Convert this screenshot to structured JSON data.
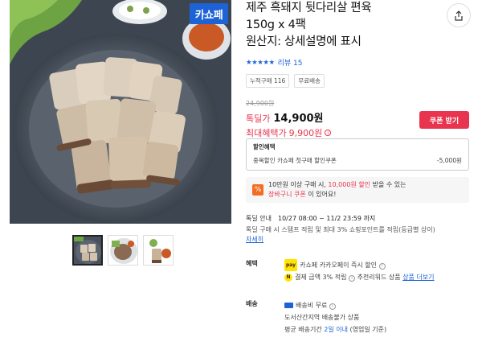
{
  "product": {
    "title_line1": "제주 흑돼지 뒷다리살 편육",
    "title_line2": "150g x 4팩",
    "title_line3": "원산지: 상세설명에 표시",
    "badge": "카쇼페",
    "stars": "★★★★★",
    "review_label": "리뷰 15",
    "chips": [
      "누적구매 116",
      "무료배송"
    ]
  },
  "price": {
    "original": "24,900원",
    "deal_label": "톡딜가",
    "deal_price": "14,900원",
    "max_label": "최대혜택가",
    "max_price": "9,900원",
    "info_icon": "i",
    "coupon_button": "쿠폰 받기"
  },
  "benefit": {
    "header": "할인혜택",
    "item_label": "중복할인 카쇼페 첫구매 할인쿠폰",
    "item_value": "-5,000원"
  },
  "promo": {
    "icon": "%",
    "text_a": "10만원 이상 구매 시, ",
    "text_highlight": "10,000원 할인",
    "text_b": " 받을 수 있는",
    "text_link": "장바구니 쿠폰",
    "text_c": "이 있어요!"
  },
  "special": {
    "label": "톡딜 안내",
    "period": "10/27 08:00 ~ 11/2 23:59 까지",
    "desc": "톡딜 구매 시 스탬프 적립 및 최대 3% 쇼핑포인트를 적립(등급별 상이)",
    "more": "자세히"
  },
  "benefits_section": {
    "label": "혜택",
    "pay_chip": "pay",
    "pay_text": "카쇼페 카카오페이 즉시 할인",
    "pay_info_icon": "i",
    "np_chip": "N",
    "point_a": "결제 금액 3% 적립",
    "point_info_icon": "i",
    "point_b": " 추천리워드 상품 ",
    "point_link": "상품 더보기"
  },
  "shipping": {
    "label": "배송",
    "free": "배송비 무료",
    "free_info_icon": "i",
    "island": "도서산간지역 배송불가 상품",
    "avg_a": "평균 배송기간 ",
    "avg_days": "2일 이내",
    "avg_b": " (영업일 기준)"
  },
  "icons": {
    "share": "share-icon",
    "star": "star-icon",
    "truck": "truck-icon",
    "info": "info-icon"
  },
  "colors": {
    "accent_blue": "#1e63d6",
    "sale_red": "#e8344e",
    "kakao_yellow": "#fee500",
    "promo_orange": "#f26d21"
  }
}
